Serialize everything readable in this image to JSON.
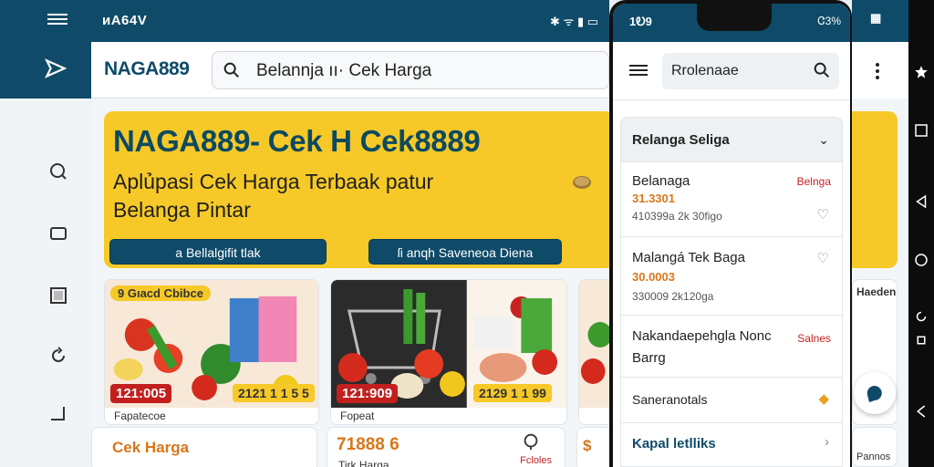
{
  "desktop": {
    "status_left": "ᴎA64V",
    "logo": "NAGA889",
    "search_value": "Belannja  ıı·  Cek Harga",
    "banner": {
      "title": "NAGA889- Cek H  Cek8889",
      "subtitle": "Aplủpasi Cek Harga Terbaak  patur Belanga Pintar",
      "button1": "a Bellalgifit tlak",
      "button2": "ſi anqh Saveneoa Diena"
    },
    "cards": [
      {
        "tag": "9 Gıacd Cbibce",
        "price": "121:005",
        "price2": "2121 1 1 5 5",
        "caption": "Fapatecoe"
      },
      {
        "tag": "",
        "price": "121:909",
        "price2": "2129 1 1 99",
        "caption": "Fopeat"
      },
      {
        "tag": "",
        "price": "",
        "price2": "",
        "caption": ""
      }
    ],
    "bottom": [
      {
        "title": "Cek Harga"
      },
      {
        "title": "71888 6",
        "sub": "Tirk Harga",
        "right": "Fcloles"
      }
    ]
  },
  "phone": {
    "time": "1Ꭷ9",
    "signal": "Ꮳ3%",
    "search_value": "Rrolenaae",
    "section_title": "Relanga Seliga",
    "rows": [
      {
        "name": "Belanaga",
        "side": "Belnga",
        "sub1": "31.3301",
        "sub2": "410399a 2k 30figo"
      },
      {
        "name": "Malangá Tek Baga",
        "sub1": "30.0003",
        "sub2": "330009 2k120ga"
      },
      {
        "name": "Nakandaepehgla Nonc",
        "side": "Salnes",
        "sub1": "Barrg",
        "sub2": ""
      },
      {
        "name": "Saneranotals",
        "sub1": "",
        "sub2": ""
      },
      {
        "name": "Kapal letlliks",
        "sub1": "",
        "sub2": ""
      }
    ]
  },
  "right": {
    "label1": "Haeden",
    "label2": "Pannos"
  },
  "colors": {
    "primary": "#0f4b68",
    "banner": "#f6c928",
    "price": "#c21f1f"
  }
}
